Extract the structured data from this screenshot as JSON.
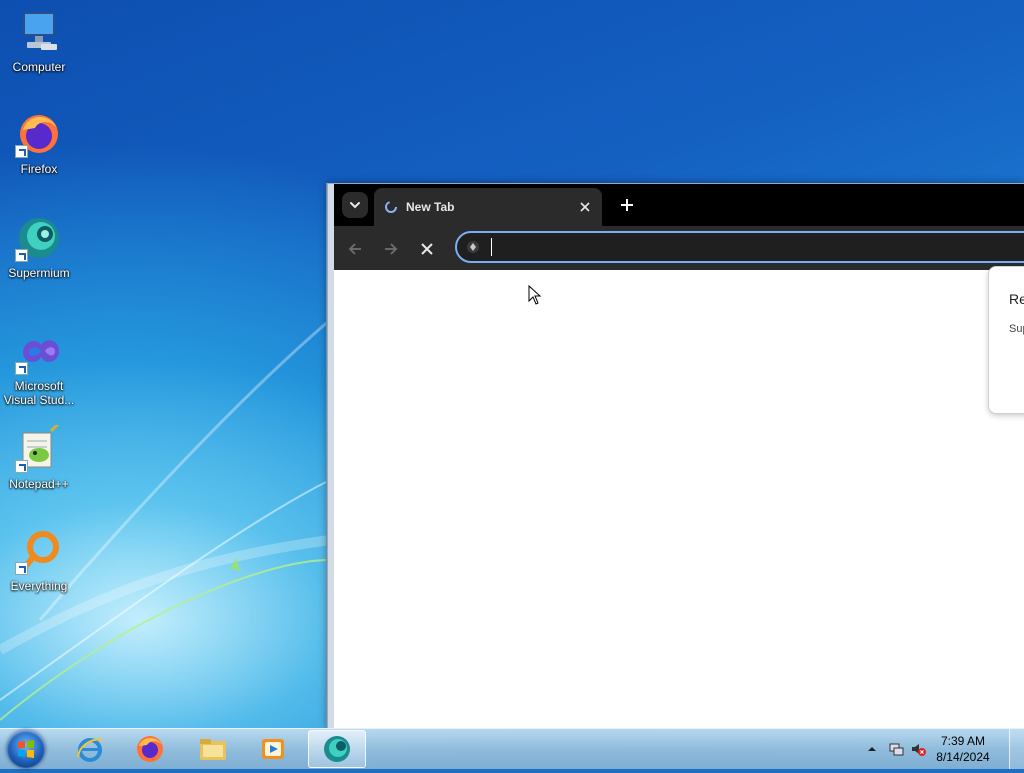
{
  "desktop": {
    "icons": [
      {
        "label": "Computer"
      },
      {
        "label": "Firefox"
      },
      {
        "label": "Supermium"
      },
      {
        "label": "Microsoft\nVisual Stud..."
      },
      {
        "label": "Notepad++"
      },
      {
        "label": "Everything"
      }
    ]
  },
  "browser": {
    "tab_title": "New Tab",
    "omnibox_value": "",
    "popup_title": "Re",
    "popup_text": "Sup",
    "colors": {
      "accent": "#7cacf8",
      "toolbar": "#2b2b2b",
      "tabstrip": "#000000"
    }
  },
  "taskbar": {
    "pinned": [
      {
        "name": "internet-explorer"
      },
      {
        "name": "firefox"
      },
      {
        "name": "file-explorer"
      },
      {
        "name": "media-player"
      },
      {
        "name": "supermium",
        "active": true
      }
    ],
    "clock": {
      "time": "7:39 AM",
      "date": "8/14/2024"
    }
  }
}
